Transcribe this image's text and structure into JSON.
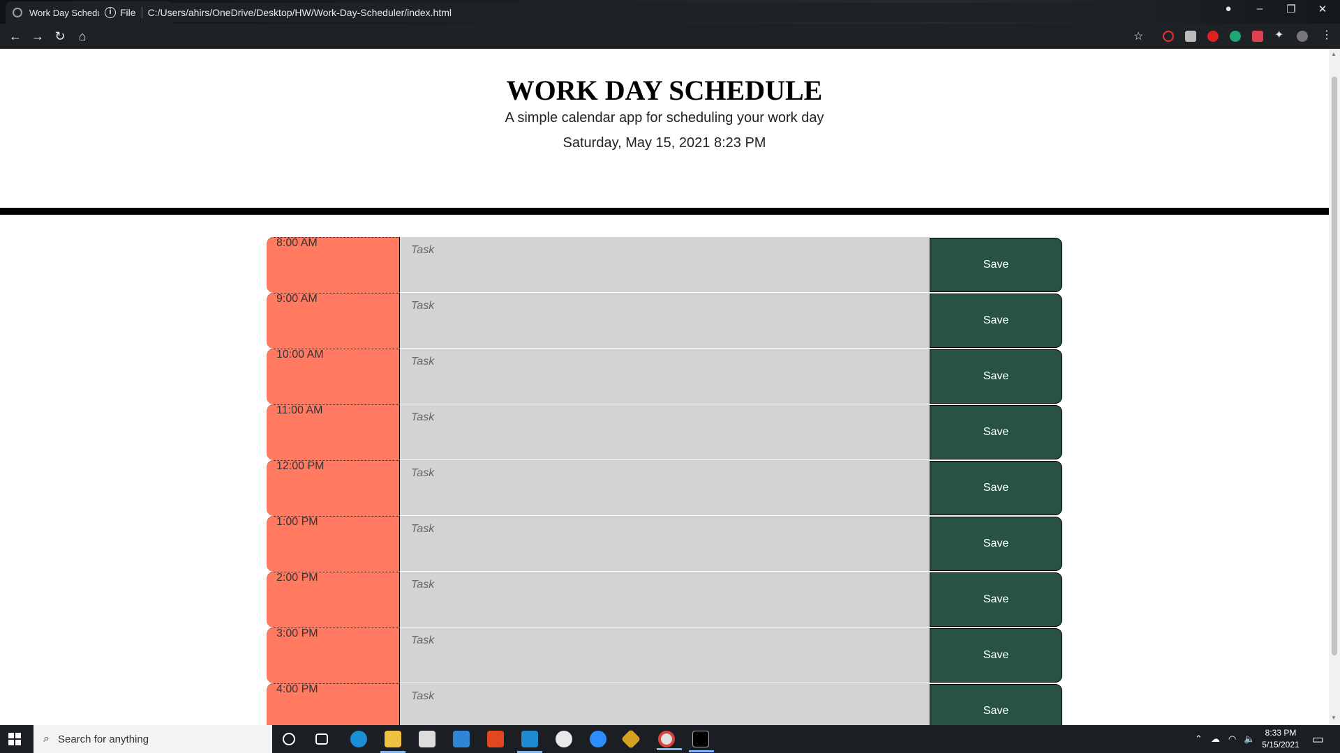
{
  "browser": {
    "tab_title": "Work Day Scheduler",
    "scheme_label": "File",
    "url": "C:/Users/ahirs/OneDrive/Desktop/HW/Work-Day-Scheduler/index.html"
  },
  "header": {
    "title": "WORK DAY SCHEDULE",
    "lead": "A simple calendar app for scheduling your work day",
    "current_datetime": "Saturday, May 15, 2021 8:23 PM"
  },
  "schedule": {
    "task_placeholder": "Task",
    "save_label": "Save",
    "hours": [
      "8:00 AM",
      "9:00 AM",
      "10:00 AM",
      "11:00 AM",
      "12:00 PM",
      "1:00 PM",
      "2:00 PM",
      "3:00 PM",
      "4:00 PM"
    ],
    "row_color_past": "#ff7a60",
    "task_bg": "#d3d3d3",
    "save_bg": "#275244"
  },
  "taskbar": {
    "search_placeholder": "Search for anything",
    "time": "8:33 PM",
    "date": "5/15/2021"
  }
}
